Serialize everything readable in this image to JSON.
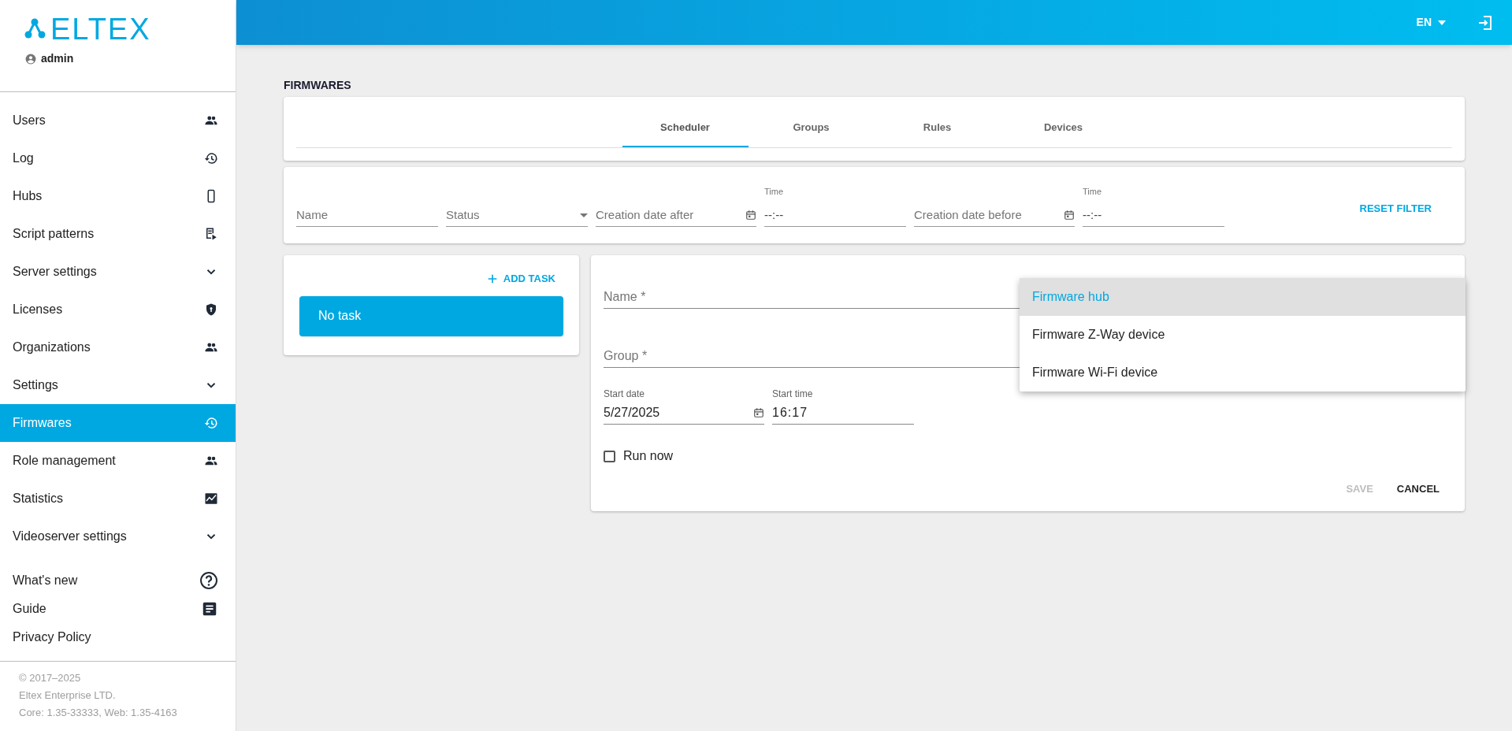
{
  "logo": {
    "text": "ELTEX"
  },
  "user": {
    "name": "admin"
  },
  "header": {
    "language": "EN"
  },
  "sidebar": {
    "items": [
      {
        "label": "Users",
        "selected": false
      },
      {
        "label": "Log",
        "selected": false
      },
      {
        "label": "Hubs",
        "selected": false
      },
      {
        "label": "Script patterns",
        "selected": false
      },
      {
        "label": "Server settings",
        "selected": false
      },
      {
        "label": "Licenses",
        "selected": false
      },
      {
        "label": "Organizations",
        "selected": false
      },
      {
        "label": "Settings",
        "selected": false
      },
      {
        "label": "Firmwares",
        "selected": true
      },
      {
        "label": "Role management",
        "selected": false
      },
      {
        "label": "Statistics",
        "selected": false
      },
      {
        "label": "Videoserver settings",
        "selected": false
      }
    ],
    "links": [
      {
        "label": "What's new"
      },
      {
        "label": "Guide"
      },
      {
        "label": "Privacy Policy"
      }
    ],
    "footer": [
      "© 2017–2025",
      "Eltex Enterprise LTD.",
      "Core: 1.35-33333, Web: 1.35-4163"
    ]
  },
  "page": {
    "title": "FIRMWARES",
    "tabs": [
      {
        "label": "Scheduler",
        "selected": true
      },
      {
        "label": "Groups",
        "selected": false
      },
      {
        "label": "Rules",
        "selected": false
      },
      {
        "label": "Devices",
        "selected": false
      }
    ],
    "filter": {
      "fields": [
        {
          "kind": "text",
          "placeholder": "Name"
        },
        {
          "kind": "select",
          "placeholder": "Status"
        },
        {
          "kind": "date",
          "placeholder": "Creation date after"
        },
        {
          "kind": "time",
          "label": "Time",
          "value": "--:--"
        },
        {
          "kind": "date",
          "placeholder": "Creation date before"
        },
        {
          "kind": "time",
          "label": "Time",
          "value": "--:--"
        }
      ],
      "reset": "RESET FILTER"
    },
    "tasks": {
      "add": "ADD TASK",
      "empty": "No task"
    },
    "form": {
      "name": {
        "placeholder": "Name *"
      },
      "group": {
        "placeholder": "Group *"
      },
      "start_date": {
        "label": "Start date",
        "value": "5/27/2025"
      },
      "start_time": {
        "label": "Start time",
        "value": "16:17"
      },
      "run_now": {
        "label": "Run now",
        "checked": false
      },
      "buttons": [
        {
          "label": "SAVE",
          "disabled": true
        },
        {
          "label": "CANCEL",
          "disabled": false
        }
      ],
      "task_type_options": [
        {
          "label": "Firmware hub",
          "selected": true
        },
        {
          "label": "Firmware Z-Way device",
          "selected": false
        },
        {
          "label": "Firmware Wi-Fi device",
          "selected": false
        }
      ]
    }
  }
}
